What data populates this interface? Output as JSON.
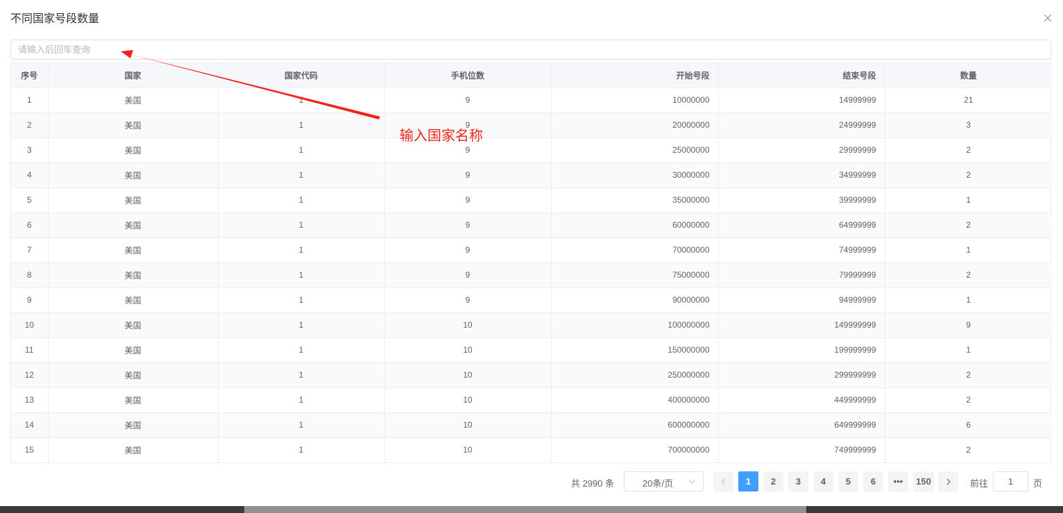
{
  "dialog": {
    "title": "不同国家号段数量",
    "search_placeholder": "请输入后回车查询"
  },
  "annotation": {
    "text": "输入国家名称",
    "color": "#f0241a"
  },
  "table": {
    "columns": [
      "序号",
      "国家",
      "国家代码",
      "手机位数",
      "开始号段",
      "结束号段",
      "数量"
    ],
    "rows": [
      [
        "1",
        "美国",
        "1",
        "9",
        "10000000",
        "14999999",
        "21"
      ],
      [
        "2",
        "美国",
        "1",
        "9",
        "20000000",
        "24999999",
        "3"
      ],
      [
        "3",
        "美国",
        "1",
        "9",
        "25000000",
        "29999999",
        "2"
      ],
      [
        "4",
        "美国",
        "1",
        "9",
        "30000000",
        "34999999",
        "2"
      ],
      [
        "5",
        "美国",
        "1",
        "9",
        "35000000",
        "39999999",
        "1"
      ],
      [
        "6",
        "美国",
        "1",
        "9",
        "60000000",
        "64999999",
        "2"
      ],
      [
        "7",
        "美国",
        "1",
        "9",
        "70000000",
        "74999999",
        "1"
      ],
      [
        "8",
        "美国",
        "1",
        "9",
        "75000000",
        "79999999",
        "2"
      ],
      [
        "9",
        "美国",
        "1",
        "9",
        "90000000",
        "94999999",
        "1"
      ],
      [
        "10",
        "美国",
        "1",
        "10",
        "100000000",
        "149999999",
        "9"
      ],
      [
        "11",
        "美国",
        "1",
        "10",
        "150000000",
        "199999999",
        "1"
      ],
      [
        "12",
        "美国",
        "1",
        "10",
        "250000000",
        "299999999",
        "2"
      ],
      [
        "13",
        "美国",
        "1",
        "10",
        "400000000",
        "449999999",
        "2"
      ],
      [
        "14",
        "美国",
        "1",
        "10",
        "600000000",
        "649999999",
        "6"
      ],
      [
        "15",
        "美国",
        "1",
        "10",
        "700000000",
        "749999999",
        "2"
      ]
    ]
  },
  "pagination": {
    "total": "共 2990 条",
    "page_size": "20条/页",
    "pages": [
      "1",
      "2",
      "3",
      "4",
      "5",
      "6"
    ],
    "more": "•••",
    "last_page": "150",
    "current": "1",
    "goto_label": "前往",
    "goto_value": "1",
    "goto_suffix": "页"
  },
  "colors": {
    "accent": "#409eff",
    "header_bg": "#f5f7fa",
    "border": "#ebeef5"
  }
}
